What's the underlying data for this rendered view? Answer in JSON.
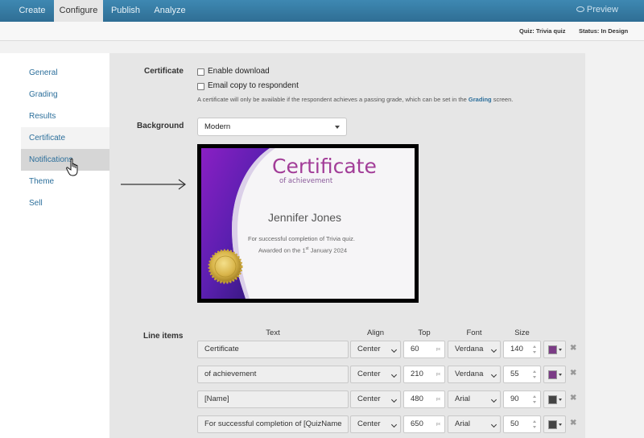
{
  "topnav": {
    "tabs": [
      {
        "label": "Create"
      },
      {
        "label": "Configure",
        "active": true
      },
      {
        "label": "Publish"
      },
      {
        "label": "Analyze"
      }
    ],
    "preview_label": "Preview"
  },
  "statusbar": {
    "quiz": "Quiz: Trivia quiz",
    "status": "Status: In Design"
  },
  "sidebar": {
    "items": [
      {
        "label": "General"
      },
      {
        "label": "Grading"
      },
      {
        "label": "Results"
      },
      {
        "label": "Certificate",
        "active": true
      },
      {
        "label": "Notifications",
        "hover": true
      },
      {
        "label": "Theme"
      },
      {
        "label": "Sell"
      }
    ]
  },
  "certificate": {
    "section_label": "Certificate",
    "enable_download_label": "Enable download",
    "enable_download_checked": false,
    "email_copy_label": "Email copy to respondent",
    "email_copy_checked": false,
    "hint_before": "A certificate will only be available if the respondent achieves a passing grade, which can be set in the",
    "hint_link": "Grading",
    "hint_after": "screen."
  },
  "background": {
    "label": "Background",
    "value": "Modern"
  },
  "preview": {
    "title": "Certificate",
    "subtitle": "of achievement",
    "name": "Jennifer Jones",
    "line1": "For successful completion of Trivia quiz.",
    "line2_prefix": "Awarded on the 1",
    "line2_sup": "st",
    "line2_suffix": " January 2024"
  },
  "line_items": {
    "label": "Line items",
    "columns": {
      "text": "Text",
      "align": "Align",
      "top": "Top",
      "font": "Font",
      "size": "Size"
    },
    "unit": "px",
    "rows": [
      {
        "text": "Certificate",
        "align": "Center",
        "top": "60",
        "font": "Verdana",
        "size": "140",
        "color": "#7b3c86"
      },
      {
        "text": "of achievement",
        "align": "Center",
        "top": "210",
        "font": "Verdana",
        "size": "55",
        "color": "#7b3c86"
      },
      {
        "text": "[Name]",
        "align": "Center",
        "top": "480",
        "font": "Arial",
        "size": "90",
        "color": "#444444"
      },
      {
        "text": "For successful completion of [QuizName",
        "align": "Center",
        "top": "650",
        "font": "Arial",
        "size": "50",
        "color": "#444444"
      }
    ]
  }
}
